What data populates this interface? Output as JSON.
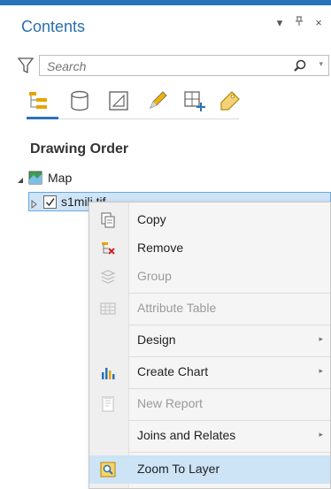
{
  "pane": {
    "title": "Contents",
    "actions": {
      "dropdown": "▾",
      "pin": "ᚎ",
      "close": "×"
    }
  },
  "search": {
    "placeholder": "Search",
    "value": ""
  },
  "toolbar": {
    "buttons": [
      {
        "name": "list-by-drawing-order-icon",
        "active": true
      },
      {
        "name": "list-by-source-icon"
      },
      {
        "name": "list-by-selection-icon"
      },
      {
        "name": "list-by-editing-icon"
      },
      {
        "name": "list-by-snapping-icon"
      },
      {
        "name": "list-by-labeling-icon"
      }
    ]
  },
  "section": {
    "heading": "Drawing Order"
  },
  "tree": {
    "map": {
      "label": "Map"
    },
    "layer": {
      "label": "s1milj.tif",
      "checked": true
    }
  },
  "context_menu": {
    "items": [
      {
        "id": "copy",
        "label": "Copy",
        "icon": "copy-icon",
        "disabled": false
      },
      {
        "id": "remove",
        "label": "Remove",
        "icon": "remove-icon",
        "disabled": false
      },
      {
        "id": "group",
        "label": "Group",
        "icon": "group-icon",
        "disabled": true
      },
      {
        "id": "attribute-table",
        "label": "Attribute Table",
        "icon": "table-icon",
        "disabled": true
      },
      {
        "id": "design",
        "label": "Design",
        "icon": "",
        "disabled": false,
        "submenu": true
      },
      {
        "id": "create-chart",
        "label": "Create Chart",
        "icon": "bar-chart-icon",
        "disabled": false,
        "submenu": true
      },
      {
        "id": "new-report",
        "label": "New Report",
        "icon": "report-icon",
        "disabled": true
      },
      {
        "id": "joins-and-relates",
        "label": "Joins and Relates",
        "icon": "",
        "disabled": false,
        "submenu": true
      },
      {
        "id": "zoom-to-layer",
        "label": "Zoom To Layer",
        "icon": "zoom-to-layer-icon",
        "disabled": false,
        "highlighted": true
      }
    ],
    "submenu_arrow": "▸"
  },
  "colors": {
    "accent": "#2a73b8",
    "selection": "#cfe4f7",
    "hover": "#cde3f6"
  }
}
